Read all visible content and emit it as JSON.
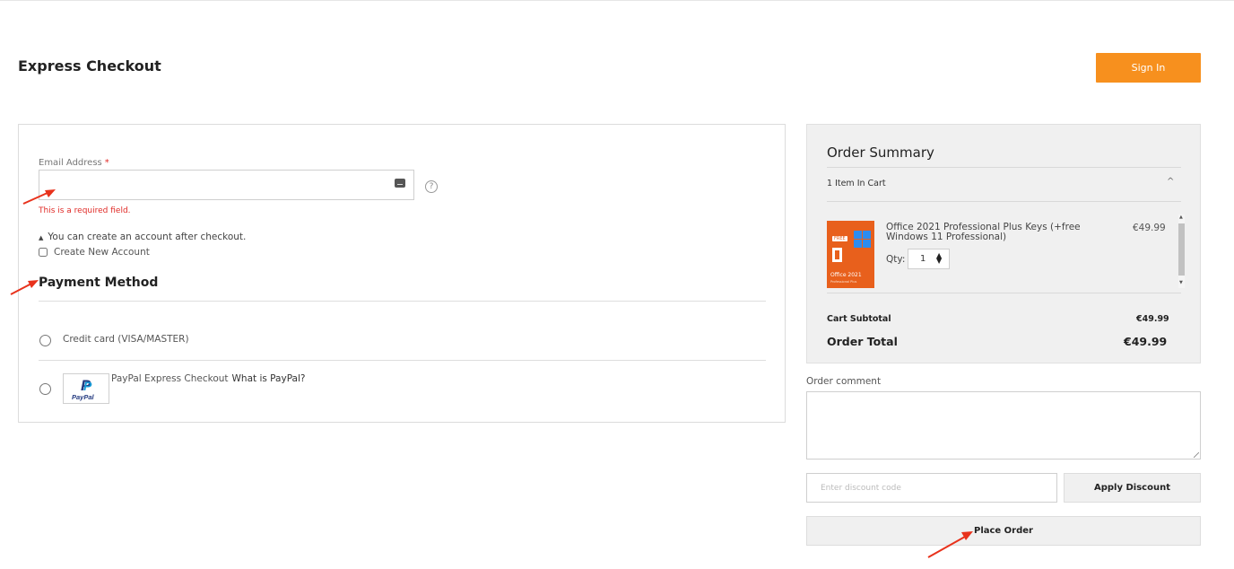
{
  "header": {
    "title": "Express Checkout",
    "signin_label": "Sign In"
  },
  "email": {
    "label": "Email Address",
    "required_mark": "*",
    "value": "",
    "error": "This is a required field.",
    "info": "You can create an account after checkout.",
    "help_icon_glyph": "?",
    "create_account_label": "Create New Account",
    "create_account_checked": false
  },
  "payment": {
    "title": "Payment Method",
    "credit_card_label": "Credit card (VISA/MASTER)",
    "paypal_label": "PayPal Express Checkout",
    "paypal_what": "What is PayPal?",
    "paypal_logo_text": "PayPal"
  },
  "summary": {
    "title": "Order Summary",
    "items_count": "1 Item In Cart",
    "product": {
      "name": "Office 2021 Professional Plus Keys (+free Windows 11 Professional)",
      "price": "€49.99",
      "qty_label": "Qty:",
      "qty": "1",
      "image_badge": "FREE",
      "image_title": "Office 2021",
      "image_subtitle": "Professional Plus"
    },
    "subtotal_label": "Cart Subtotal",
    "subtotal_value": "€49.99",
    "total_label": "Order Total",
    "total_value": "€49.99"
  },
  "comment": {
    "label": "Order comment",
    "value": ""
  },
  "discount": {
    "placeholder": "Enter discount code",
    "apply_label": "Apply Discount"
  },
  "place_order_label": "Place Order",
  "colors": {
    "accent": "#f7901e",
    "error": "#e02b27",
    "annotation_arrow": "#e8321c"
  }
}
